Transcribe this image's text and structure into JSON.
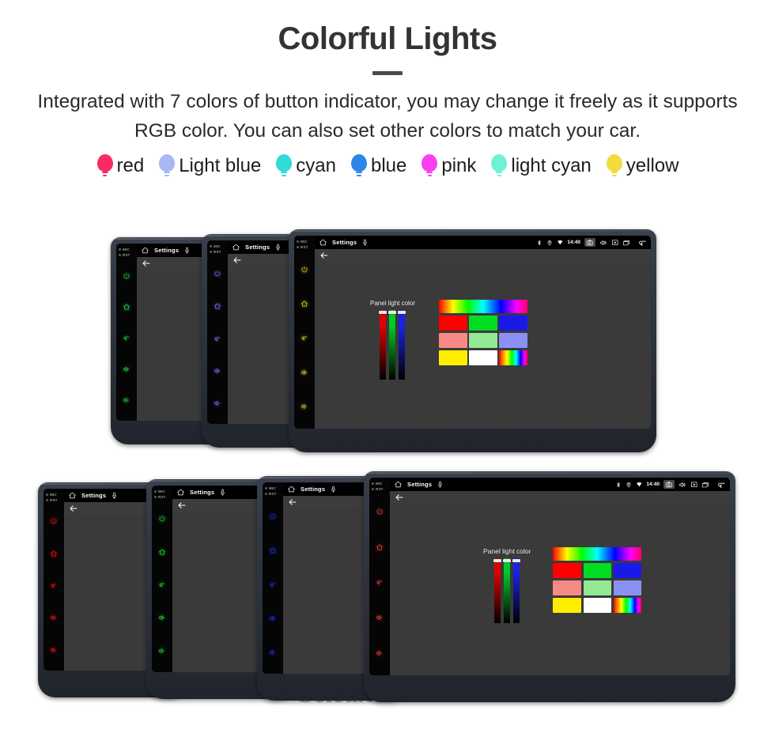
{
  "header": {
    "title": "Colorful Lights",
    "subtitle": "Integrated with 7 colors of button indicator, you may change it freely as it supports RGB color. You can also set other colors to match your car."
  },
  "legend": {
    "items": [
      {
        "label": "red",
        "color": "#fa2a63"
      },
      {
        "label": "Light blue",
        "color": "#a9b7f5"
      },
      {
        "label": "cyan",
        "color": "#31dbd8"
      },
      {
        "label": "blue",
        "color": "#2f86ea"
      },
      {
        "label": "pink",
        "color": "#f93ff0"
      },
      {
        "label": "light cyan",
        "color": "#6ef2d4"
      },
      {
        "label": "yellow",
        "color": "#f2dc3c"
      }
    ]
  },
  "device_ui": {
    "home_icon": "home-icon",
    "title": "Settings",
    "mic_icon": "microphone-icon",
    "status_icons": [
      "bluetooth-icon",
      "location-icon",
      "wifi-icon"
    ],
    "clock": "14:40",
    "nav_icons": [
      "camera-icon",
      "volume-icon",
      "close-box-icon",
      "recents-icon",
      "back-icon"
    ],
    "back_arrow": "back-arrow-icon",
    "side_labels": [
      "MIC",
      "RST"
    ],
    "side_buttons": [
      "power-icon",
      "home-icon",
      "back-icon",
      "volume-up-icon",
      "volume-down-icon"
    ],
    "panel_label": "Panel light color",
    "sliders": [
      {
        "name": "red-slider",
        "color": "#e00000"
      },
      {
        "name": "green-slider",
        "color": "#00cc22"
      },
      {
        "name": "blue-slider",
        "color": "#1a22e6"
      }
    ],
    "swatches": [
      [
        "#ff0000",
        "#00dd22",
        "#1a1ae8"
      ],
      [
        "#f78a84",
        "#92e894",
        "#8a91f2"
      ],
      [
        "#ffee00",
        "#ffffff",
        "rainbow"
      ]
    ],
    "rainbow_name": "rainbow-gradient-bar"
  },
  "clusters": {
    "top": {
      "units": [
        {
          "name": "device-unit-green",
          "light": "#28d44a"
        },
        {
          "name": "device-unit-lightblue",
          "light": "#7b6df0"
        },
        {
          "name": "device-unit-yellow",
          "light": "#f2d021"
        }
      ]
    },
    "bottom": {
      "units": [
        {
          "name": "device-unit-red-1",
          "light": "#f01818"
        },
        {
          "name": "device-unit-green",
          "light": "#18e02a"
        },
        {
          "name": "device-unit-blue",
          "light": "#1a32f0"
        },
        {
          "name": "device-unit-red-2",
          "light": "#e8403c"
        }
      ]
    }
  },
  "watermark": {
    "text": "Seicane"
  }
}
